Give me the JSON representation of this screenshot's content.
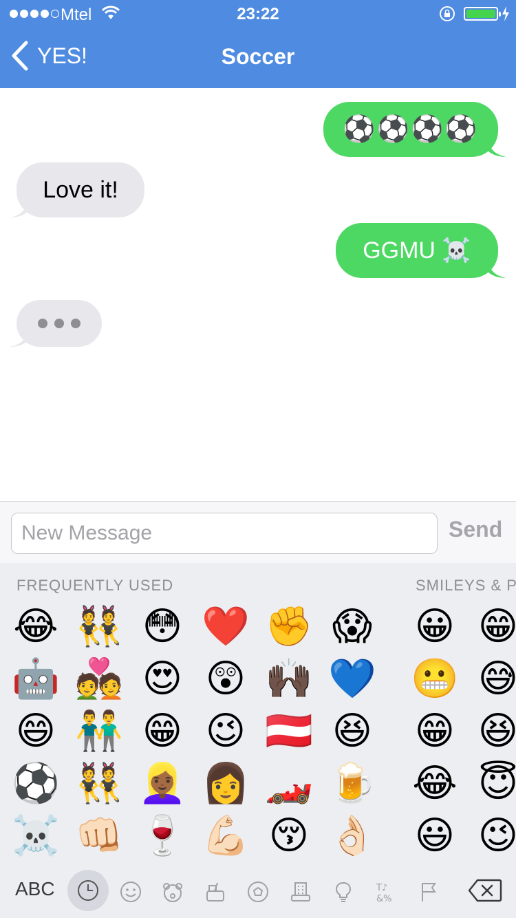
{
  "status": {
    "carrier": "Mtel",
    "time": "23:22"
  },
  "nav": {
    "back_label": "YES!",
    "title": "Soccer"
  },
  "messages": [
    {
      "direction": "outgoing",
      "text": "⚽⚽⚽⚽"
    },
    {
      "direction": "incoming",
      "text": "Love it!"
    },
    {
      "direction": "outgoing",
      "text": "GGMU ☠️"
    },
    {
      "direction": "incoming",
      "typing": true
    }
  ],
  "composer": {
    "placeholder": "New Message",
    "send_label": "Send"
  },
  "keyboard": {
    "sections": {
      "frequently_used": "FREQUENTLY USED",
      "smileys": "SMILEYS & P"
    },
    "grid": [
      [
        "😂",
        "👯",
        "😳",
        "❤️",
        "✊",
        "😱",
        "😀",
        "😁"
      ],
      [
        "🤖",
        "💑",
        "😍",
        "😲",
        "🙌🏿",
        "💙",
        "😬",
        "😅"
      ],
      [
        "😄",
        "👬",
        "😁",
        "😉",
        "🇦🇹",
        "😆",
        "😁",
        "😆"
      ],
      [
        "⚽",
        "👯",
        "👱🏾‍♀️",
        "👩",
        "🏎️",
        "🍺",
        "😂",
        "😇"
      ],
      [
        "☠️",
        "👊🏻",
        "🍷",
        "💪🏻",
        "😚",
        "👌🏻",
        "😃",
        "😉"
      ]
    ],
    "abc_label": "ABC",
    "categories": [
      "recent-icon",
      "smiley-icon",
      "bear-icon",
      "food-icon",
      "ball-icon",
      "building-icon",
      "bulb-icon",
      "symbols-icon",
      "flag-icon"
    ],
    "colors": {
      "header": "#4f8be0",
      "outgoing_bubble": "#4cd862",
      "incoming_bubble": "#e8e7ec",
      "keyboard_bg": "#eceef2"
    }
  }
}
